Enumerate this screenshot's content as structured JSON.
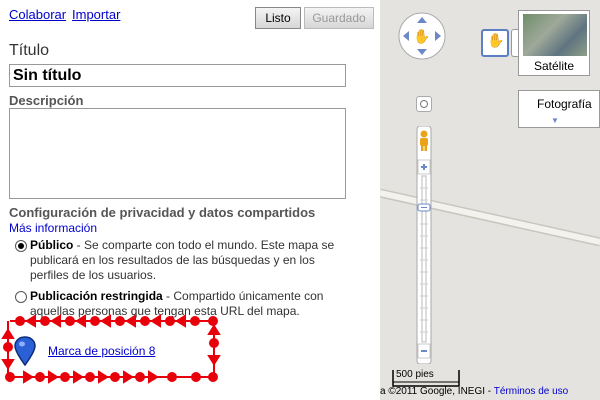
{
  "header": {
    "collaborate_link": "Colaborar",
    "import_link": "Importar",
    "done_button": "Listo",
    "saved_button": "Guardado"
  },
  "form": {
    "title_label": "Título",
    "title_value": "Sin título",
    "description_label": "Descripción",
    "description_value": ""
  },
  "privacy": {
    "heading": "Configuración de privacidad y datos compartidos",
    "more_info_link": "Más información",
    "options": [
      {
        "title": "Público",
        "text": " - Se comparte con todo el mundo. Este mapa se publicará en los resultados de las búsquedas y en los perfiles de los usuarios.",
        "selected": true
      },
      {
        "title": "Publicación restringida",
        "text": " - Compartido únicamente con aquellas personas que tengan esta URL del mapa.",
        "selected": false
      }
    ]
  },
  "placemark": {
    "label": "Marca de posición 8",
    "marker_icon": "blue-map-pin-icon"
  },
  "map": {
    "satellite_label": "Satélite",
    "photos_label": "Fotografía",
    "scale_label": "500 pies",
    "copyright_text": "a ©2011 Google, INEGI",
    "terms_link": "Términos de uso",
    "selection_color": "#e8000b",
    "link_color": "#0000cc"
  }
}
